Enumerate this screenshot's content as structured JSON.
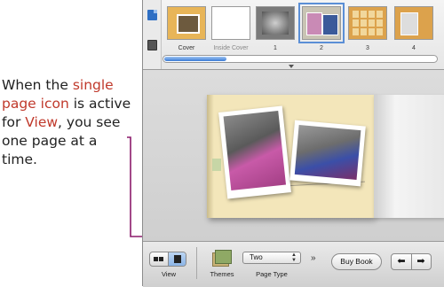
{
  "callout": {
    "line1_pre": "When the ",
    "line1_hl": "single",
    "line2_hl": "page icon",
    "line2_post": " is active",
    "line3_pre": "for ",
    "line3_hl": "View",
    "line3_post": ", you see",
    "line4": "one page at a time."
  },
  "colors": {
    "highlight": "#c0392b",
    "connector": "#8b1a6b",
    "selection": "#5b8fd6"
  },
  "sidebar": {
    "icons": [
      "page-icon",
      "photo-browser-icon"
    ]
  },
  "pages": [
    {
      "label": "Cover",
      "selected": false
    },
    {
      "label": "Inside Cover",
      "selected": false
    },
    {
      "label": "1",
      "selected": false
    },
    {
      "label": "2",
      "selected": true
    },
    {
      "label": "3",
      "selected": false
    },
    {
      "label": "4",
      "selected": false
    }
  ],
  "toolbar": {
    "view_label": "View",
    "themes_label": "Themes",
    "page_type_value": "Two",
    "page_type_label": "Page Type",
    "more_label": "»",
    "buy_book_label": "Buy Book",
    "prev_label": "⬅",
    "next_label": "➡",
    "active_view": "single"
  }
}
